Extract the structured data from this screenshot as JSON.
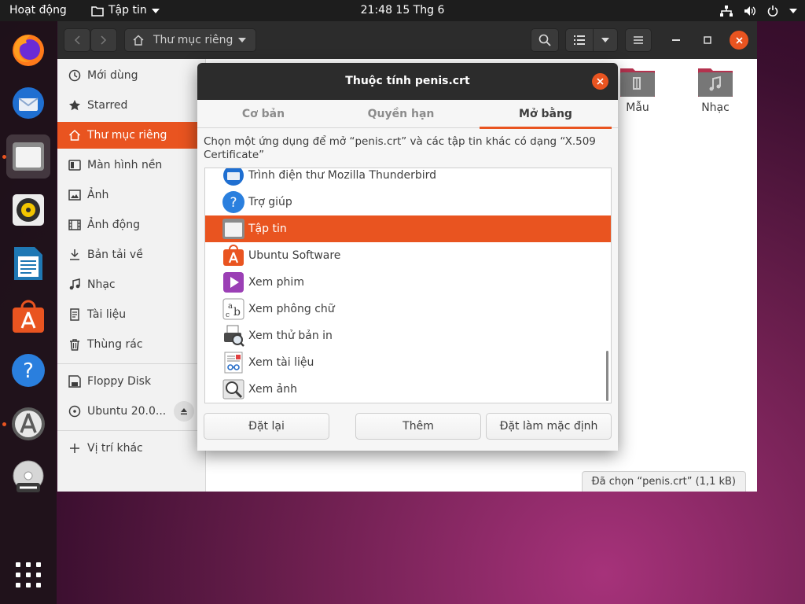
{
  "topbar": {
    "activities": "Hoạt động",
    "app_name": "Tập tin",
    "clock": "21:48  15 Thg 6"
  },
  "dock": {
    "items": [
      {
        "name": "firefox-icon"
      },
      {
        "name": "thunderbird-icon"
      },
      {
        "name": "files-icon",
        "active": true
      },
      {
        "name": "rhythmbox-icon"
      },
      {
        "name": "libreoffice-writer-icon"
      },
      {
        "name": "ubuntu-software-icon"
      },
      {
        "name": "help-icon"
      },
      {
        "name": "software-updater-icon"
      },
      {
        "name": "dvd-icon"
      },
      {
        "name": "show-applications-icon"
      }
    ]
  },
  "files_window": {
    "path_label": "Thư mục riêng",
    "sidebar": {
      "items": [
        {
          "label": "Mới dùng",
          "icon": "clock-icon"
        },
        {
          "label": "Starred",
          "icon": "star-icon"
        },
        {
          "label": "Thư mục riêng",
          "icon": "home-icon",
          "selected": true
        },
        {
          "label": "Màn hình nền",
          "icon": "desktop-icon"
        },
        {
          "label": "Ảnh",
          "icon": "image-icon"
        },
        {
          "label": "Ảnh động",
          "icon": "film-icon"
        },
        {
          "label": "Bản tải về",
          "icon": "download-icon"
        },
        {
          "label": "Nhạc",
          "icon": "music-icon"
        },
        {
          "label": "Tài liệu",
          "icon": "document-icon"
        },
        {
          "label": "Thùng rác",
          "icon": "trash-icon"
        }
      ],
      "devices": [
        {
          "label": "Floppy Disk",
          "icon": "floppy-icon"
        },
        {
          "label": "Ubuntu 20.0...",
          "icon": "disc-icon"
        }
      ],
      "other_locations": "Vị trí khác"
    },
    "folders": [
      {
        "label": "Mẫu",
        "icon": "templates-folder-icon"
      },
      {
        "label": "Nhạc",
        "icon": "music-folder-icon"
      }
    ],
    "status": "Đã chọn “penis.crt” (1,1 kB)"
  },
  "dialog": {
    "title": "Thuộc tính penis.crt",
    "tabs": [
      {
        "label": "Cơ bản"
      },
      {
        "label": "Quyền hạn"
      },
      {
        "label": "Mở bằng",
        "active": true
      }
    ],
    "description_line1": "Chọn một ứng dụng để mở “penis.crt” và các tập tin khác có dạng “X.509",
    "description_line2": "Certificate”",
    "apps": [
      {
        "label": "Trình điện thư Mozilla Thunderbird",
        "icon": "thunderbird-icon"
      },
      {
        "label": "Trợ giúp",
        "icon": "help-icon"
      },
      {
        "label": "Tập tin",
        "icon": "files-icon",
        "selected": true
      },
      {
        "label": "Ubuntu Software",
        "icon": "ubuntu-software-icon"
      },
      {
        "label": "Xem phim",
        "icon": "video-player-icon"
      },
      {
        "label": "Xem phông chữ",
        "icon": "font-viewer-icon"
      },
      {
        "label": "Xem thử bản in",
        "icon": "print-preview-icon"
      },
      {
        "label": "Xem tài liệu",
        "icon": "document-viewer-icon"
      },
      {
        "label": "Xem ảnh",
        "icon": "image-viewer-icon"
      }
    ],
    "buttons": {
      "reset": "Đặt lại",
      "add": "Thêm",
      "set_default": "Đặt làm mặc định"
    }
  },
  "colors": {
    "accent": "#e95420",
    "headerbar": "#2c2c2c",
    "topbar": "#1d1d1d"
  }
}
